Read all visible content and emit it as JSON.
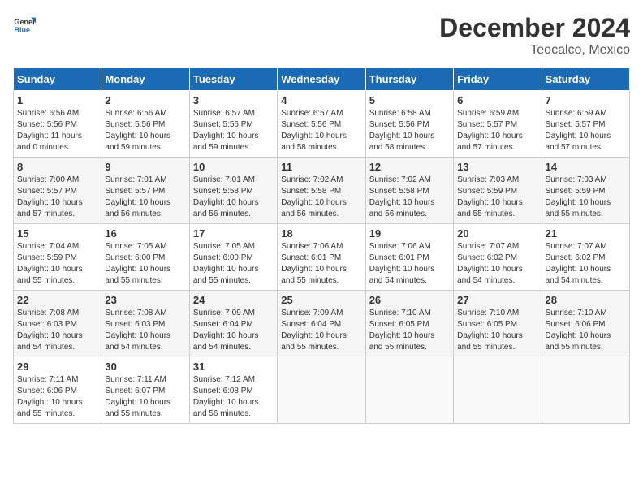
{
  "header": {
    "logo_line1": "General",
    "logo_line2": "Blue",
    "month": "December 2024",
    "location": "Teocalco, Mexico"
  },
  "days_of_week": [
    "Sunday",
    "Monday",
    "Tuesday",
    "Wednesday",
    "Thursday",
    "Friday",
    "Saturday"
  ],
  "weeks": [
    [
      {
        "day": "1",
        "sunrise": "6:56 AM",
        "sunset": "5:56 PM",
        "daylight": "11 hours and 0 minutes."
      },
      {
        "day": "2",
        "sunrise": "6:56 AM",
        "sunset": "5:56 PM",
        "daylight": "10 hours and 59 minutes."
      },
      {
        "day": "3",
        "sunrise": "6:57 AM",
        "sunset": "5:56 PM",
        "daylight": "10 hours and 59 minutes."
      },
      {
        "day": "4",
        "sunrise": "6:57 AM",
        "sunset": "5:56 PM",
        "daylight": "10 hours and 58 minutes."
      },
      {
        "day": "5",
        "sunrise": "6:58 AM",
        "sunset": "5:56 PM",
        "daylight": "10 hours and 58 minutes."
      },
      {
        "day": "6",
        "sunrise": "6:59 AM",
        "sunset": "5:57 PM",
        "daylight": "10 hours and 57 minutes."
      },
      {
        "day": "7",
        "sunrise": "6:59 AM",
        "sunset": "5:57 PM",
        "daylight": "10 hours and 57 minutes."
      }
    ],
    [
      {
        "day": "8",
        "sunrise": "7:00 AM",
        "sunset": "5:57 PM",
        "daylight": "10 hours and 57 minutes."
      },
      {
        "day": "9",
        "sunrise": "7:01 AM",
        "sunset": "5:57 PM",
        "daylight": "10 hours and 56 minutes."
      },
      {
        "day": "10",
        "sunrise": "7:01 AM",
        "sunset": "5:58 PM",
        "daylight": "10 hours and 56 minutes."
      },
      {
        "day": "11",
        "sunrise": "7:02 AM",
        "sunset": "5:58 PM",
        "daylight": "10 hours and 56 minutes."
      },
      {
        "day": "12",
        "sunrise": "7:02 AM",
        "sunset": "5:58 PM",
        "daylight": "10 hours and 56 minutes."
      },
      {
        "day": "13",
        "sunrise": "7:03 AM",
        "sunset": "5:59 PM",
        "daylight": "10 hours and 55 minutes."
      },
      {
        "day": "14",
        "sunrise": "7:03 AM",
        "sunset": "5:59 PM",
        "daylight": "10 hours and 55 minutes."
      }
    ],
    [
      {
        "day": "15",
        "sunrise": "7:04 AM",
        "sunset": "5:59 PM",
        "daylight": "10 hours and 55 minutes."
      },
      {
        "day": "16",
        "sunrise": "7:05 AM",
        "sunset": "6:00 PM",
        "daylight": "10 hours and 55 minutes."
      },
      {
        "day": "17",
        "sunrise": "7:05 AM",
        "sunset": "6:00 PM",
        "daylight": "10 hours and 55 minutes."
      },
      {
        "day": "18",
        "sunrise": "7:06 AM",
        "sunset": "6:01 PM",
        "daylight": "10 hours and 55 minutes."
      },
      {
        "day": "19",
        "sunrise": "7:06 AM",
        "sunset": "6:01 PM",
        "daylight": "10 hours and 54 minutes."
      },
      {
        "day": "20",
        "sunrise": "7:07 AM",
        "sunset": "6:02 PM",
        "daylight": "10 hours and 54 minutes."
      },
      {
        "day": "21",
        "sunrise": "7:07 AM",
        "sunset": "6:02 PM",
        "daylight": "10 hours and 54 minutes."
      }
    ],
    [
      {
        "day": "22",
        "sunrise": "7:08 AM",
        "sunset": "6:03 PM",
        "daylight": "10 hours and 54 minutes."
      },
      {
        "day": "23",
        "sunrise": "7:08 AM",
        "sunset": "6:03 PM",
        "daylight": "10 hours and 54 minutes."
      },
      {
        "day": "24",
        "sunrise": "7:09 AM",
        "sunset": "6:04 PM",
        "daylight": "10 hours and 54 minutes."
      },
      {
        "day": "25",
        "sunrise": "7:09 AM",
        "sunset": "6:04 PM",
        "daylight": "10 hours and 55 minutes."
      },
      {
        "day": "26",
        "sunrise": "7:10 AM",
        "sunset": "6:05 PM",
        "daylight": "10 hours and 55 minutes."
      },
      {
        "day": "27",
        "sunrise": "7:10 AM",
        "sunset": "6:05 PM",
        "daylight": "10 hours and 55 minutes."
      },
      {
        "day": "28",
        "sunrise": "7:10 AM",
        "sunset": "6:06 PM",
        "daylight": "10 hours and 55 minutes."
      }
    ],
    [
      {
        "day": "29",
        "sunrise": "7:11 AM",
        "sunset": "6:06 PM",
        "daylight": "10 hours and 55 minutes."
      },
      {
        "day": "30",
        "sunrise": "7:11 AM",
        "sunset": "6:07 PM",
        "daylight": "10 hours and 55 minutes."
      },
      {
        "day": "31",
        "sunrise": "7:12 AM",
        "sunset": "6:08 PM",
        "daylight": "10 hours and 56 minutes."
      },
      null,
      null,
      null,
      null
    ]
  ],
  "labels": {
    "sunrise": "Sunrise:",
    "sunset": "Sunset:",
    "daylight": "Daylight:"
  }
}
